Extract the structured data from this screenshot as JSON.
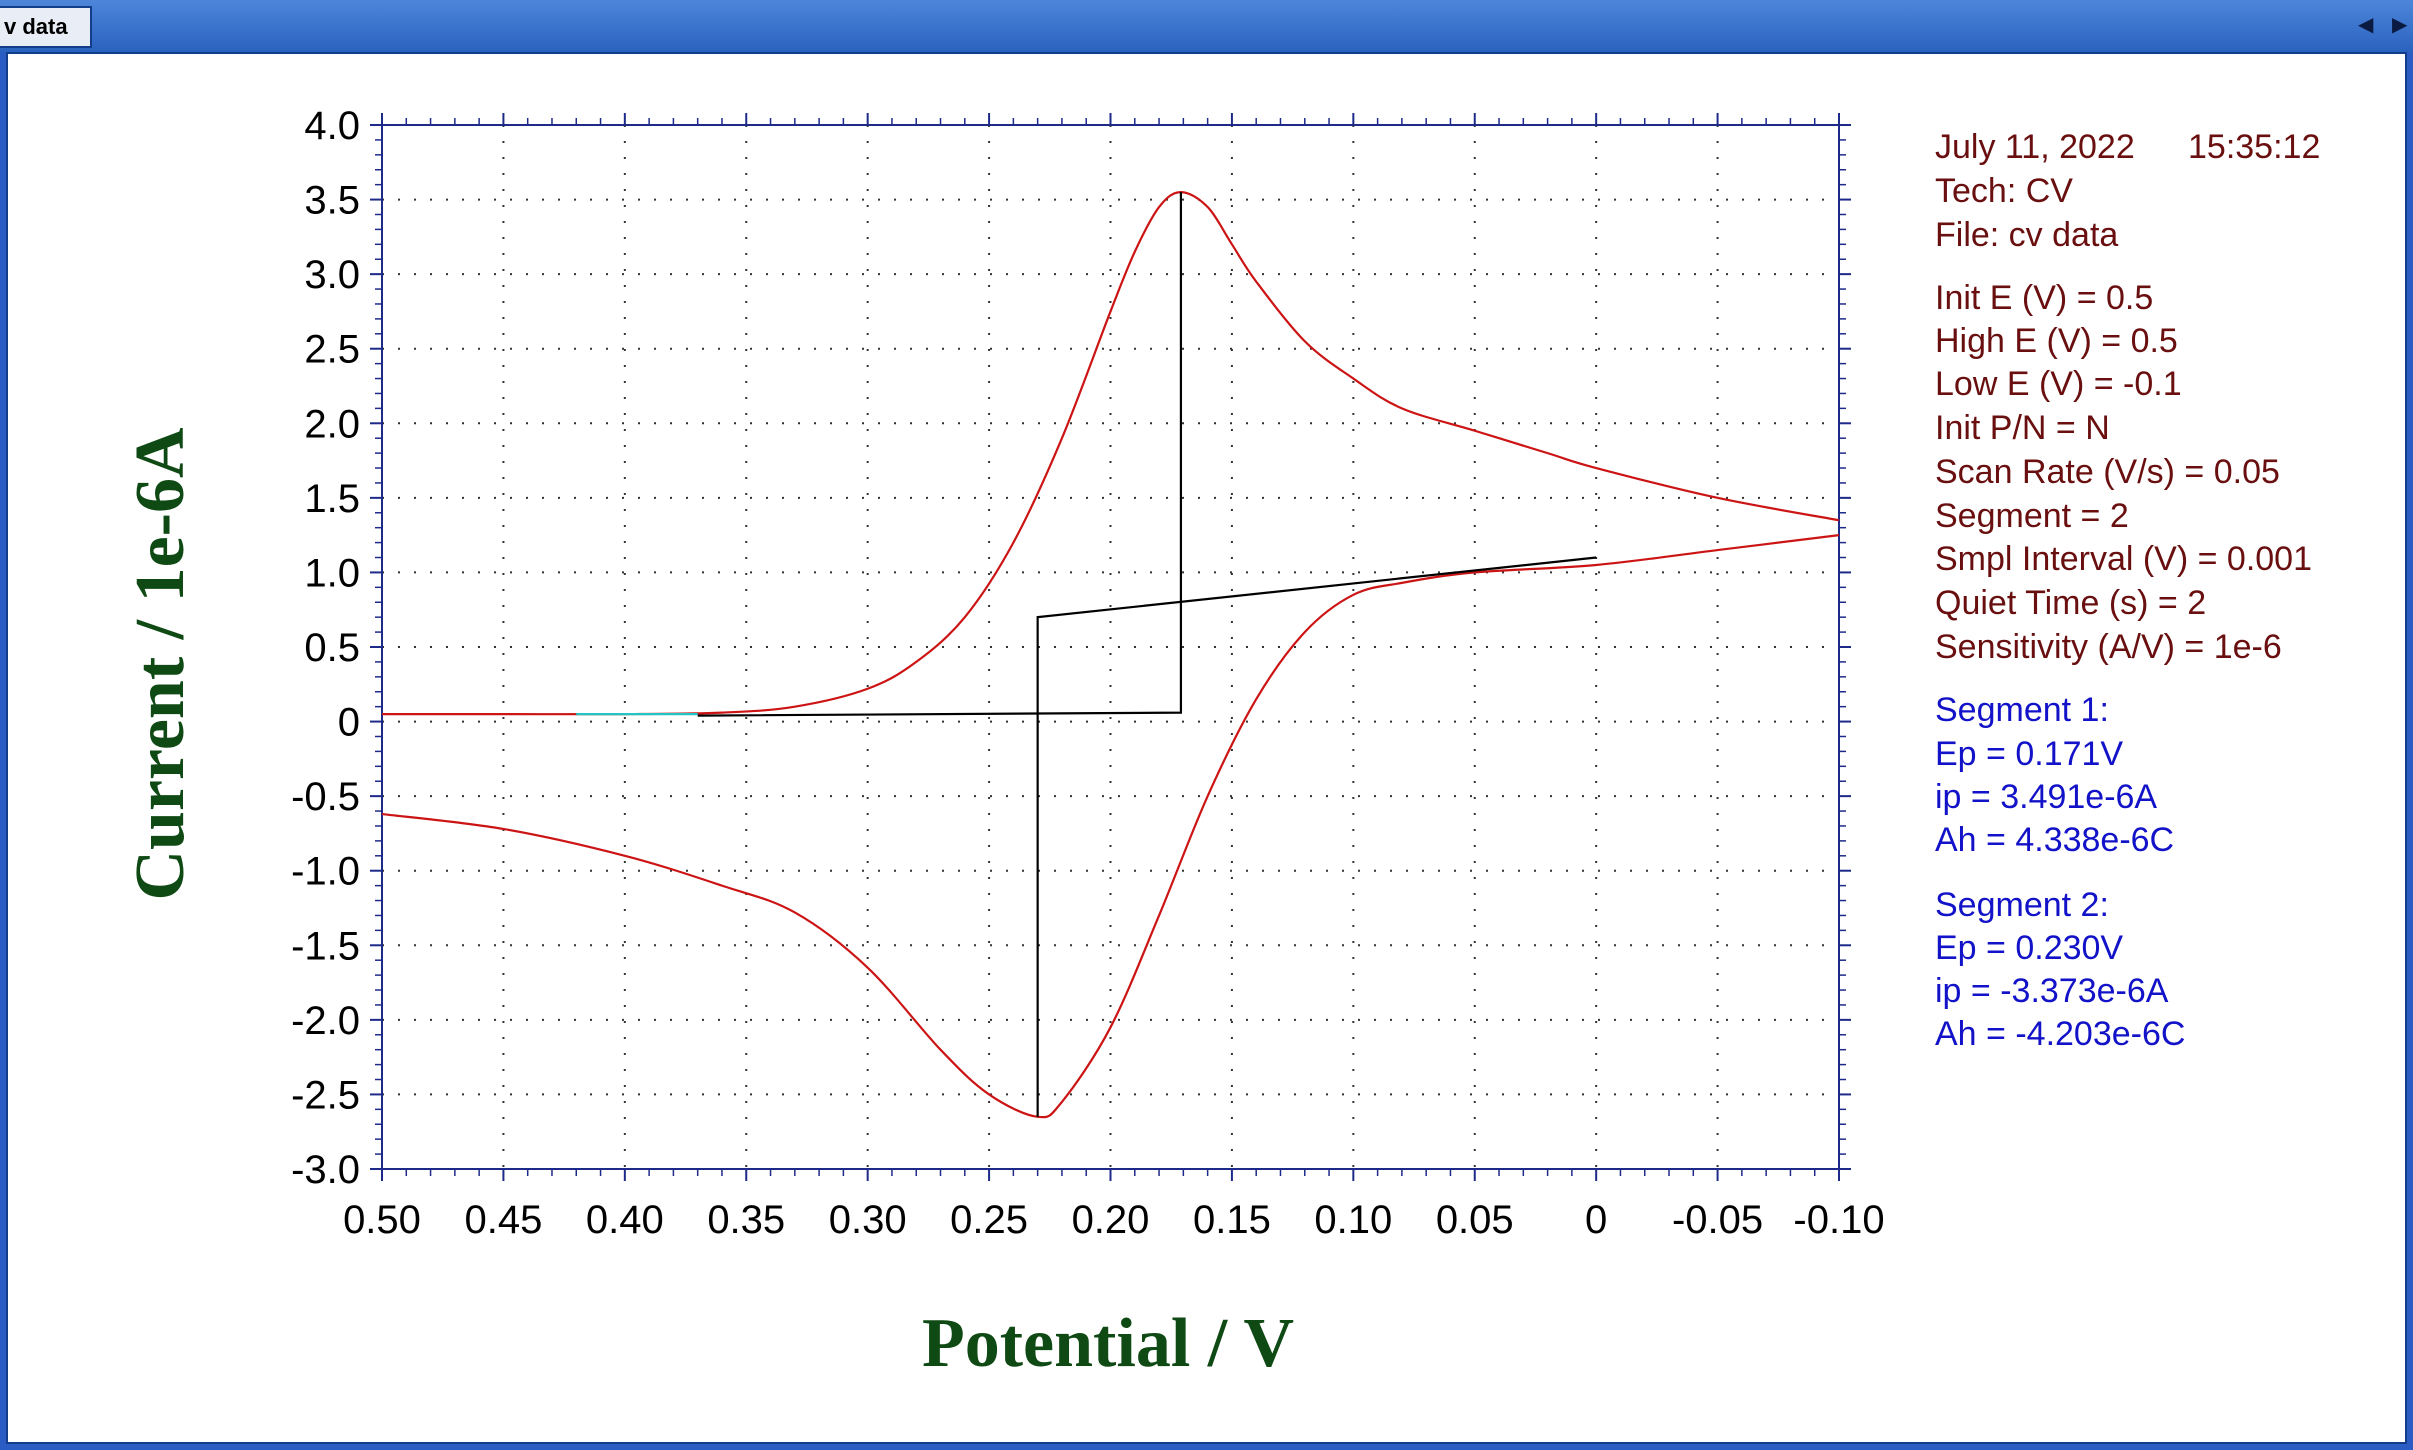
{
  "window": {
    "tab_label": "v data",
    "nav_left": "◀",
    "nav_right": "▶"
  },
  "colors": {
    "title": "#0f4a14",
    "info_text": "#6a0f0f",
    "segment_text": "#1212c8",
    "scan_curve": "#cc1414",
    "baseline": "#000000",
    "highlight": "#22c4c4"
  },
  "info": {
    "date": "July 11, 2022",
    "time": "15:35:12",
    "params": [
      "Tech: CV",
      "File: cv data"
    ],
    "settings": [
      "Init E (V) = 0.5",
      "High E (V) = 0.5",
      "Low E (V) = -0.1",
      "Init P/N = N",
      "Scan Rate (V/s) = 0.05",
      "Segment = 2",
      "Smpl Interval (V) = 0.001",
      "Quiet Time (s) = 2",
      "Sensitivity (A/V) = 1e-6"
    ],
    "segments": [
      {
        "title": "Segment 1:",
        "ep": "Ep = 0.171V",
        "ip": "ip = 3.491e-6A",
        "ah": "Ah = 4.338e-6C"
      },
      {
        "title": "Segment 2:",
        "ep": "Ep = 0.230V",
        "ip": "ip = -3.373e-6A",
        "ah": "Ah = -4.203e-6C"
      }
    ]
  },
  "chart_data": {
    "type": "line",
    "xlabel": "Potential / V",
    "ylabel": "Current / 1e-6A",
    "xlim": [
      0.5,
      -0.1
    ],
    "ylim": [
      -3.0,
      4.0
    ],
    "x_reversed": true,
    "grid": true,
    "x_ticks": [
      0.5,
      0.45,
      0.4,
      0.35,
      0.3,
      0.25,
      0.2,
      0.15,
      0.1,
      0.05,
      0,
      -0.05,
      -0.1
    ],
    "x_tick_labels": [
      "0.50",
      "0.45",
      "0.40",
      "0.35",
      "0.30",
      "0.25",
      "0.20",
      "0.15",
      "0.10",
      "0.05",
      "0",
      "-0.05",
      "-0.10"
    ],
    "y_ticks": [
      4.0,
      3.5,
      3.0,
      2.5,
      2.0,
      1.5,
      1.0,
      0.5,
      0,
      -0.5,
      -1.0,
      -1.5,
      -2.0,
      -2.5,
      -3.0
    ],
    "y_tick_labels": [
      "4.0",
      "3.5",
      "3.0",
      "2.5",
      "2.0",
      "1.5",
      "1.0",
      "0.5",
      "0",
      "-0.5",
      "-1.0",
      "-1.5",
      "-2.0",
      "-2.5",
      "-3.0"
    ],
    "series": [
      {
        "role": "forward_scan",
        "color": "#cc1414",
        "x": [
          0.5,
          0.45,
          0.4,
          0.36,
          0.33,
          0.3,
          0.28,
          0.26,
          0.24,
          0.22,
          0.2,
          0.19,
          0.18,
          0.171,
          0.16,
          0.15,
          0.14,
          0.12,
          0.1,
          0.08,
          0.05,
          0.02,
          0.0,
          -0.05,
          -0.1
        ],
        "y": [
          0.05,
          0.05,
          0.05,
          0.06,
          0.1,
          0.22,
          0.4,
          0.7,
          1.2,
          1.9,
          2.75,
          3.15,
          3.45,
          3.55,
          3.45,
          3.2,
          2.95,
          2.55,
          2.3,
          2.1,
          1.95,
          1.8,
          1.7,
          1.5,
          1.35
        ]
      },
      {
        "role": "reverse_scan",
        "color": "#cc1414",
        "x": [
          -0.1,
          -0.05,
          0.0,
          0.05,
          0.08,
          0.1,
          0.12,
          0.14,
          0.16,
          0.18,
          0.2,
          0.22,
          0.23,
          0.25,
          0.27,
          0.3,
          0.33,
          0.36,
          0.4,
          0.45,
          0.5
        ],
        "y": [
          1.25,
          1.15,
          1.05,
          1.0,
          0.93,
          0.85,
          0.6,
          0.15,
          -0.5,
          -1.3,
          -2.05,
          -2.55,
          -2.65,
          -2.5,
          -2.2,
          -1.65,
          -1.28,
          -1.1,
          -0.9,
          -0.72,
          -0.62
        ]
      },
      {
        "role": "peak_baseline_1",
        "color": "#000000",
        "x": [
          0.37,
          0.171,
          0.171
        ],
        "y": [
          0.04,
          0.06,
          3.55
        ]
      },
      {
        "role": "peak_baseline_2",
        "color": "#000000",
        "x": [
          0.23,
          0.23,
          0.23,
          0.0
        ],
        "y": [
          -2.65,
          0.7,
          0.7,
          1.1
        ]
      },
      {
        "role": "highlight",
        "color": "#22c4c4",
        "x": [
          0.42,
          0.37
        ],
        "y": [
          0.05,
          0.05
        ]
      }
    ]
  }
}
